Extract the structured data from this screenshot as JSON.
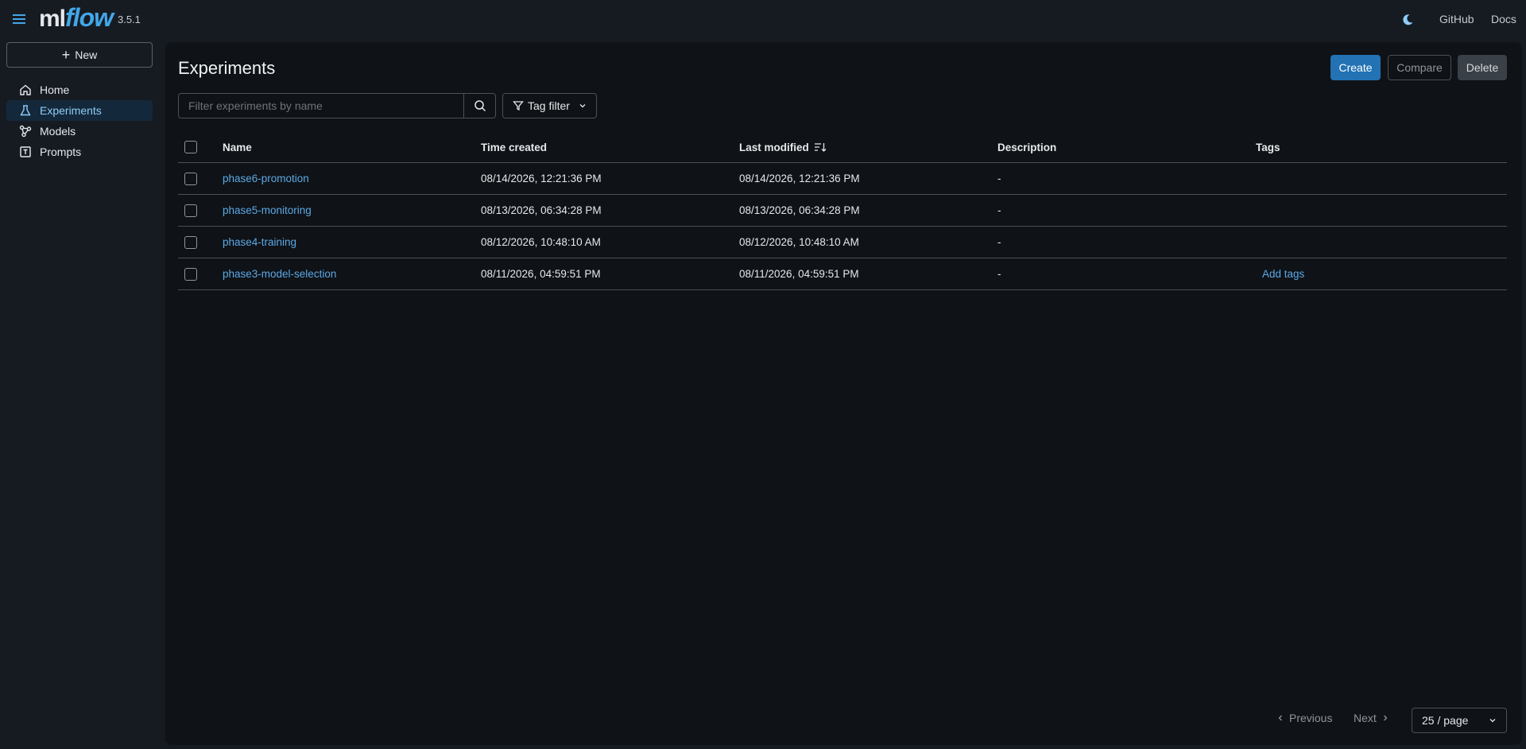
{
  "app": {
    "logo_ml": "ml",
    "logo_flow": "flow",
    "version": "3.5.1",
    "github_label": "GitHub",
    "docs_label": "Docs"
  },
  "sidebar": {
    "new_label": "New",
    "items": [
      {
        "label": "Home",
        "icon": "home-icon",
        "active": false
      },
      {
        "label": "Experiments",
        "icon": "flask-icon",
        "active": true
      },
      {
        "label": "Models",
        "icon": "models-icon",
        "active": false
      },
      {
        "label": "Prompts",
        "icon": "prompts-icon",
        "active": false
      }
    ]
  },
  "main": {
    "title": "Experiments",
    "create_label": "Create",
    "compare_label": "Compare",
    "delete_label": "Delete",
    "search_placeholder": "Filter experiments by name",
    "tag_filter_label": "Tag filter",
    "table": {
      "headers": {
        "name": "Name",
        "created": "Time created",
        "modified": "Last modified",
        "description": "Description",
        "tags": "Tags"
      },
      "rows": [
        {
          "name": "phase6-promotion",
          "created": "08/14/2026, 12:21:36 PM",
          "modified": "08/14/2026, 12:21:36 PM",
          "description": "-",
          "tags": ""
        },
        {
          "name": "phase5-monitoring",
          "created": "08/13/2026, 06:34:28 PM",
          "modified": "08/13/2026, 06:34:28 PM",
          "description": "-",
          "tags": ""
        },
        {
          "name": "phase4-training",
          "created": "08/12/2026, 10:48:10 AM",
          "modified": "08/12/2026, 10:48:10 AM",
          "description": "-",
          "tags": ""
        },
        {
          "name": "phase3-model-selection",
          "created": "08/11/2026, 04:59:51 PM",
          "modified": "08/11/2026, 04:59:51 PM",
          "description": "-",
          "tags": "Add tags"
        }
      ]
    },
    "pagination": {
      "previous_label": "Previous",
      "next_label": "Next",
      "page_size_label": "25 / page"
    }
  },
  "colors": {
    "accent": "#2272b4",
    "link": "#5aa9e6",
    "active_nav_bg": "#14283b"
  }
}
